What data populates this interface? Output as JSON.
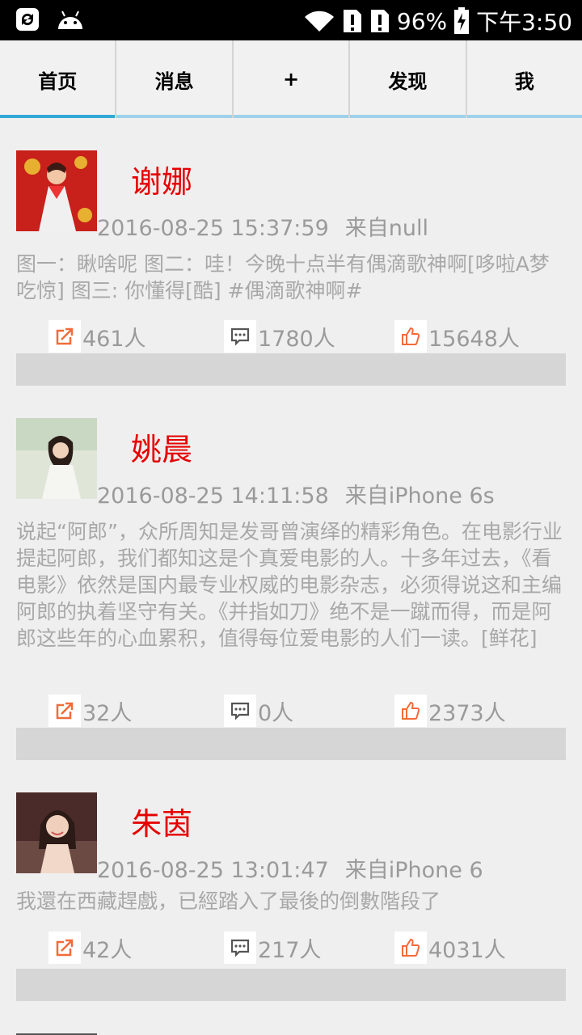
{
  "status_bar": {
    "battery": "96%",
    "time": "下午3:50"
  },
  "tabs": [
    {
      "label": "首页"
    },
    {
      "label": "消息"
    },
    {
      "label": "+"
    },
    {
      "label": "发现"
    },
    {
      "label": "我"
    }
  ],
  "posts": [
    {
      "name": "谢娜",
      "time": "2016-08-25 15:37:59",
      "source": "来自null",
      "text": "图一：瞅啥呢  图二：哇！今晚十点半有偶滴歌神啊[哆啦A梦吃惊] 图三: 你懂得[酷]  #偶滴歌神啊#",
      "reposts": "461人",
      "comments": "1780人",
      "likes": "15648人"
    },
    {
      "name": "姚晨",
      "time": "2016-08-25 14:11:58",
      "source": "来自iPhone 6s",
      "text": "说起“阿郎”，众所周知是发哥曾演绎的精彩角色。在电影行业提起阿郎，我们都知这是个真爱电影的人。十多年过去，《看电影》依然是国内最专业权威的电影杂志，必须得说这和主编阿郎的执着坚守有关。《并指如刀》绝不是一蹴而得，而是阿郎这些年的心血累积，值得每位爱电影的人们一读。[鲜花]",
      "reposts": "32人",
      "comments": "0人",
      "likes": "2373人"
    },
    {
      "name": "朱茵",
      "time": "2016-08-25 13:01:47",
      "source": "来自iPhone 6",
      "text": "我還在西藏趕戲，已經踏入了最後的倒數階段了",
      "reposts": "42人",
      "comments": "217人",
      "likes": "4031人"
    }
  ],
  "icons": {
    "repost": "repost-icon",
    "comment": "comment-icon",
    "like": "thumbs-up-icon"
  },
  "colors": {
    "accent": "#34a7d9",
    "name": "#e60000",
    "icon": "#f26b3a"
  }
}
